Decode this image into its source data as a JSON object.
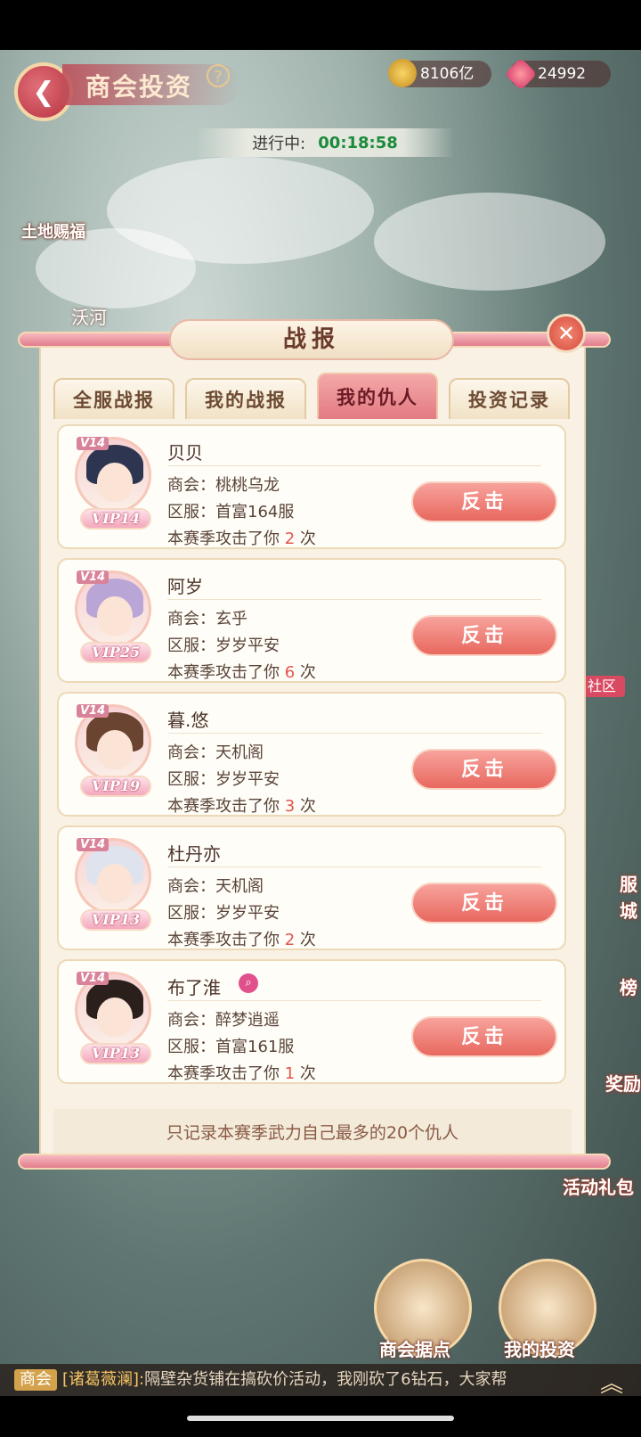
{
  "header": {
    "title": "商会投资",
    "help": "?",
    "coins": "8106亿",
    "gems": "24992"
  },
  "status": {
    "label": "进行中:",
    "time": "00:18:58"
  },
  "map_labels": {
    "blessing": "土地赐福",
    "river": "沃河",
    "community": "社区",
    "right_1": "服",
    "right_2": "城",
    "right_3": "榜",
    "right_4": "奖励",
    "activity_gift": "活动礼包"
  },
  "modal": {
    "title": "战报",
    "close": "✕",
    "tabs": [
      "全服战报",
      "我的战报",
      "我的仇人",
      "投资记录"
    ],
    "active_tab": 2,
    "label_guild": "商会：",
    "label_server": "区服：",
    "attack_prefix": "本赛季攻击了你",
    "attack_suffix": "次",
    "counter_label": "反击",
    "vip_small": "V14",
    "enemies": [
      {
        "name": "贝贝",
        "guild": "桃桃乌龙",
        "server": "首富164服",
        "count": "2",
        "vip": "VIP14",
        "hair": "#2d3550"
      },
      {
        "name": "阿岁",
        "guild": "玄乎",
        "server": "岁岁平安",
        "count": "6",
        "vip": "VIP25",
        "hair": "#b9a6d6"
      },
      {
        "name": "暮.悠",
        "guild": "天机阁",
        "server": "岁岁平安",
        "count": "3",
        "vip": "VIP19",
        "hair": "#6b4331"
      },
      {
        "name": "杜丹亦",
        "guild": "天机阁",
        "server": "岁岁平安",
        "count": "2",
        "vip": "VIP13",
        "hair": "#dfe3ee"
      },
      {
        "name": "布了淮",
        "guild": "醉梦逍遥",
        "server": "首富161服",
        "count": "1",
        "vip": "VIP13",
        "hair": "#2b1f1c"
      }
    ],
    "footer": "只记录本赛季武力自己最多的20个仇人"
  },
  "bottom": {
    "guild_base": "商会据点",
    "my_invest": "我的投资"
  },
  "ticker": {
    "tag": "商会",
    "speaker": "[诸葛薇澜]:",
    "message": "隔壁杂货铺在搞砍价活动，我刚砍了6钻石，大家帮"
  },
  "colors": {
    "accent": "#e8685f",
    "active_tab": "#e27b82",
    "highlight_num": "#e2554c"
  }
}
